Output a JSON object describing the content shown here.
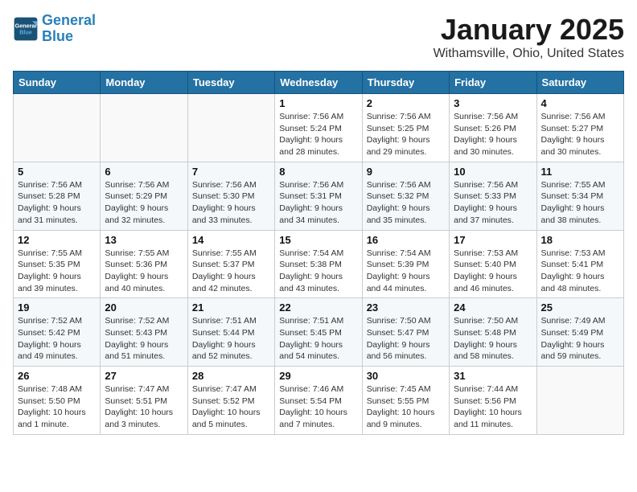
{
  "header": {
    "logo_line1": "General",
    "logo_line2": "Blue",
    "month": "January 2025",
    "location": "Withamsville, Ohio, United States"
  },
  "days_of_week": [
    "Sunday",
    "Monday",
    "Tuesday",
    "Wednesday",
    "Thursday",
    "Friday",
    "Saturday"
  ],
  "weeks": [
    [
      {
        "day": "",
        "info": ""
      },
      {
        "day": "",
        "info": ""
      },
      {
        "day": "",
        "info": ""
      },
      {
        "day": "1",
        "info": "Sunrise: 7:56 AM\nSunset: 5:24 PM\nDaylight: 9 hours\nand 28 minutes."
      },
      {
        "day": "2",
        "info": "Sunrise: 7:56 AM\nSunset: 5:25 PM\nDaylight: 9 hours\nand 29 minutes."
      },
      {
        "day": "3",
        "info": "Sunrise: 7:56 AM\nSunset: 5:26 PM\nDaylight: 9 hours\nand 30 minutes."
      },
      {
        "day": "4",
        "info": "Sunrise: 7:56 AM\nSunset: 5:27 PM\nDaylight: 9 hours\nand 30 minutes."
      }
    ],
    [
      {
        "day": "5",
        "info": "Sunrise: 7:56 AM\nSunset: 5:28 PM\nDaylight: 9 hours\nand 31 minutes."
      },
      {
        "day": "6",
        "info": "Sunrise: 7:56 AM\nSunset: 5:29 PM\nDaylight: 9 hours\nand 32 minutes."
      },
      {
        "day": "7",
        "info": "Sunrise: 7:56 AM\nSunset: 5:30 PM\nDaylight: 9 hours\nand 33 minutes."
      },
      {
        "day": "8",
        "info": "Sunrise: 7:56 AM\nSunset: 5:31 PM\nDaylight: 9 hours\nand 34 minutes."
      },
      {
        "day": "9",
        "info": "Sunrise: 7:56 AM\nSunset: 5:32 PM\nDaylight: 9 hours\nand 35 minutes."
      },
      {
        "day": "10",
        "info": "Sunrise: 7:56 AM\nSunset: 5:33 PM\nDaylight: 9 hours\nand 37 minutes."
      },
      {
        "day": "11",
        "info": "Sunrise: 7:55 AM\nSunset: 5:34 PM\nDaylight: 9 hours\nand 38 minutes."
      }
    ],
    [
      {
        "day": "12",
        "info": "Sunrise: 7:55 AM\nSunset: 5:35 PM\nDaylight: 9 hours\nand 39 minutes."
      },
      {
        "day": "13",
        "info": "Sunrise: 7:55 AM\nSunset: 5:36 PM\nDaylight: 9 hours\nand 40 minutes."
      },
      {
        "day": "14",
        "info": "Sunrise: 7:55 AM\nSunset: 5:37 PM\nDaylight: 9 hours\nand 42 minutes."
      },
      {
        "day": "15",
        "info": "Sunrise: 7:54 AM\nSunset: 5:38 PM\nDaylight: 9 hours\nand 43 minutes."
      },
      {
        "day": "16",
        "info": "Sunrise: 7:54 AM\nSunset: 5:39 PM\nDaylight: 9 hours\nand 44 minutes."
      },
      {
        "day": "17",
        "info": "Sunrise: 7:53 AM\nSunset: 5:40 PM\nDaylight: 9 hours\nand 46 minutes."
      },
      {
        "day": "18",
        "info": "Sunrise: 7:53 AM\nSunset: 5:41 PM\nDaylight: 9 hours\nand 48 minutes."
      }
    ],
    [
      {
        "day": "19",
        "info": "Sunrise: 7:52 AM\nSunset: 5:42 PM\nDaylight: 9 hours\nand 49 minutes."
      },
      {
        "day": "20",
        "info": "Sunrise: 7:52 AM\nSunset: 5:43 PM\nDaylight: 9 hours\nand 51 minutes."
      },
      {
        "day": "21",
        "info": "Sunrise: 7:51 AM\nSunset: 5:44 PM\nDaylight: 9 hours\nand 52 minutes."
      },
      {
        "day": "22",
        "info": "Sunrise: 7:51 AM\nSunset: 5:45 PM\nDaylight: 9 hours\nand 54 minutes."
      },
      {
        "day": "23",
        "info": "Sunrise: 7:50 AM\nSunset: 5:47 PM\nDaylight: 9 hours\nand 56 minutes."
      },
      {
        "day": "24",
        "info": "Sunrise: 7:50 AM\nSunset: 5:48 PM\nDaylight: 9 hours\nand 58 minutes."
      },
      {
        "day": "25",
        "info": "Sunrise: 7:49 AM\nSunset: 5:49 PM\nDaylight: 9 hours\nand 59 minutes."
      }
    ],
    [
      {
        "day": "26",
        "info": "Sunrise: 7:48 AM\nSunset: 5:50 PM\nDaylight: 10 hours\nand 1 minute."
      },
      {
        "day": "27",
        "info": "Sunrise: 7:47 AM\nSunset: 5:51 PM\nDaylight: 10 hours\nand 3 minutes."
      },
      {
        "day": "28",
        "info": "Sunrise: 7:47 AM\nSunset: 5:52 PM\nDaylight: 10 hours\nand 5 minutes."
      },
      {
        "day": "29",
        "info": "Sunrise: 7:46 AM\nSunset: 5:54 PM\nDaylight: 10 hours\nand 7 minutes."
      },
      {
        "day": "30",
        "info": "Sunrise: 7:45 AM\nSunset: 5:55 PM\nDaylight: 10 hours\nand 9 minutes."
      },
      {
        "day": "31",
        "info": "Sunrise: 7:44 AM\nSunset: 5:56 PM\nDaylight: 10 hours\nand 11 minutes."
      },
      {
        "day": "",
        "info": ""
      }
    ]
  ]
}
